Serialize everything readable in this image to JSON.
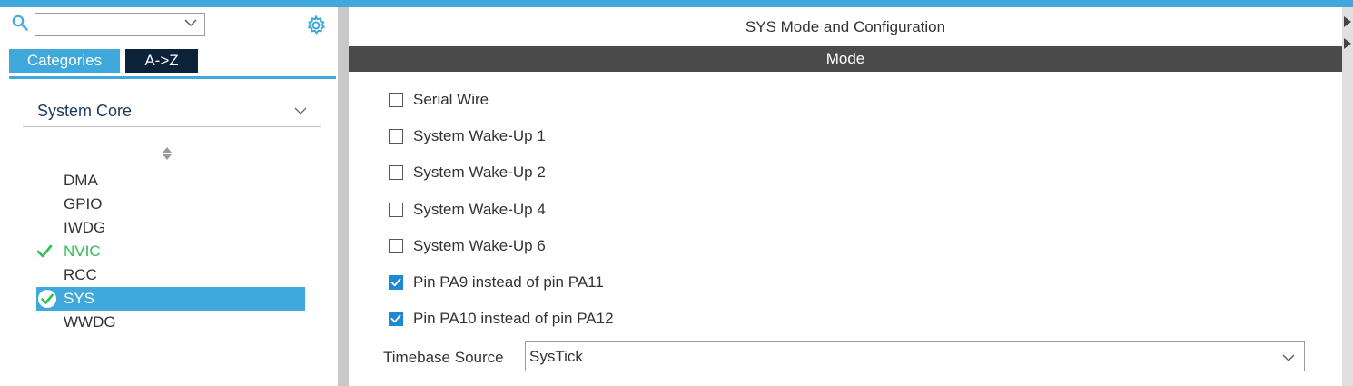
{
  "colors": {
    "accent": "#3fa9dc",
    "dark_tab": "#0c2238",
    "ok_green": "#2fbd57",
    "mode_bar": "#4b4b4b",
    "checkbox_checked": "#1e88d2"
  },
  "search": {
    "value": ""
  },
  "tabs": [
    {
      "label": "Categories",
      "active": true
    },
    {
      "label": "A->Z",
      "active": false
    }
  ],
  "category": {
    "selected": "System Core"
  },
  "components": [
    {
      "label": "DMA",
      "status": "none"
    },
    {
      "label": "GPIO",
      "status": "none"
    },
    {
      "label": "IWDG",
      "status": "none"
    },
    {
      "label": "NVIC",
      "status": "ok"
    },
    {
      "label": "RCC",
      "status": "none"
    },
    {
      "label": "SYS",
      "status": "selected"
    },
    {
      "label": "WWDG",
      "status": "none"
    }
  ],
  "panel": {
    "title": "SYS Mode and Configuration",
    "mode_header": "Mode",
    "options": [
      {
        "label": "Serial Wire",
        "checked": false
      },
      {
        "label": "System Wake-Up 1",
        "checked": false
      },
      {
        "label": "System Wake-Up 2",
        "checked": false
      },
      {
        "label": "System Wake-Up 4",
        "checked": false
      },
      {
        "label": "System Wake-Up 6",
        "checked": false
      },
      {
        "label": "Pin PA9 instead of pin PA11",
        "checked": true
      },
      {
        "label": "Pin PA10 instead of pin PA12",
        "checked": true
      }
    ],
    "timebase_label": "Timebase Source",
    "timebase_value": "SysTick"
  }
}
